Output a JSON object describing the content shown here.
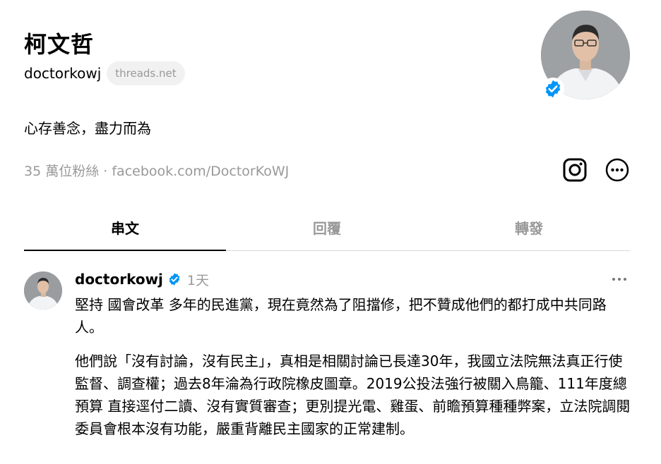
{
  "profile": {
    "name": "柯文哲",
    "handle": "doctorkowj",
    "domain_badge": "threads.net",
    "bio": "心存善念，盡力而為",
    "followers": "35 萬位粉絲",
    "separator": "·",
    "link": "facebook.com/DoctorKoWJ",
    "verified_color": "#0095f6"
  },
  "tabs": [
    {
      "label": "串文",
      "active": true
    },
    {
      "label": "回覆",
      "active": false
    },
    {
      "label": "轉發",
      "active": false
    }
  ],
  "post": {
    "username": "doctorkowj",
    "time": "1天",
    "paragraph1": "堅持 國會改革 多年的民進黨，現在竟然為了阻擋修，把不贊成他們的都打成中共同路人。",
    "paragraph2": "他們說「沒有討論，沒有民主」，真相是相關討論已長達30年，我國立法院無法真正行使監督、調查權；過去8年淪為行政院橡皮圖章。2019公投法強行被關入鳥籠、111年度總預算 直接逕付二讀、沒有實質審查；更別提光電、雞蛋、前瞻預算種種弊案，立法院調閱委員會根本沒有功能，嚴重背離民主國家的正常建制。"
  },
  "icons": {
    "instagram": "instagram-icon",
    "more": "more-circle-icon",
    "post_more": "ellipsis-icon",
    "verified": "verified-check-icon"
  }
}
